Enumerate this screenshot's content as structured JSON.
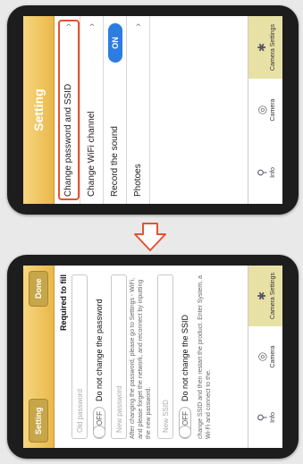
{
  "top": {
    "title": "Setting",
    "rows": [
      {
        "label": "Change password and SSID",
        "highlighted": true
      },
      {
        "label": "Change WiFi channel"
      },
      {
        "label": "Record the sound",
        "toggle": "ON"
      },
      {
        "label": "Photoes"
      }
    ],
    "tabs": [
      {
        "label": "Info",
        "icon": "antenna-icon"
      },
      {
        "label": "Camera",
        "icon": "camera-icon"
      },
      {
        "label": "Camera Settings",
        "icon": "wrench-icon",
        "active": true
      }
    ]
  },
  "bottom": {
    "left_button": "Setting",
    "right_button": "Done",
    "required_label": "Required to fill",
    "fields": [
      {
        "placeholder": "Old password"
      },
      {
        "placeholder": "New password"
      },
      {
        "placeholder": "New SSID"
      }
    ],
    "switches": [
      {
        "state": "OFF",
        "label": "Do not change the password"
      },
      {
        "state": "OFF",
        "label": "Do not change the SSID"
      }
    ],
    "notes": [
      "After changing the password, please go to Settings - WiFi, and please forget the network, and reconnect by inputting the new password.",
      "change SSID and then restart the product. Enter System, a Wi-Fi and connect to the."
    ],
    "tabs": [
      {
        "label": "Info",
        "icon": "antenna-icon"
      },
      {
        "label": "Camera",
        "icon": "camera-icon"
      },
      {
        "label": "Camera Settings",
        "icon": "wrench-icon",
        "active": true
      }
    ]
  },
  "colors": {
    "accent_orange": "#e4532f",
    "navbar_gold": "#e9b84a",
    "toggle_blue": "#2d7ce0",
    "arrow": "#e4532f"
  }
}
